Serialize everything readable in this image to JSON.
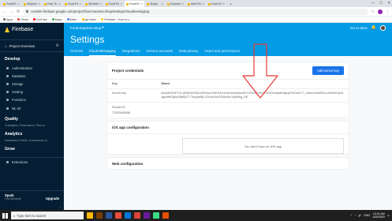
{
  "browser": {
    "tabs": [
      {
        "label": "Fossil Exo",
        "active": false
      },
      {
        "label": "Stripe/co",
        "active": false
      },
      {
        "label": "How To Se",
        "active": false
      },
      {
        "label": "Food Expr",
        "active": false
      },
      {
        "label": "Servlets",
        "active": false
      },
      {
        "label": "Food Exp",
        "active": false
      },
      {
        "label": "Fossil Exp",
        "active": true
      },
      {
        "label": "Shops",
        "active": false
      },
      {
        "label": "Document",
        "active": false
      },
      {
        "label": "Add Fireb",
        "active": false
      },
      {
        "label": "Food Exp",
        "active": false
      }
    ],
    "url": "console.firebase.google.com/project/food-express-shop/settings/cloudmessaging",
    "bookmarks": [
      "Apps",
      "Gmail",
      "YouTube",
      "Maps",
      "flutter",
      "get token",
      "Firebase - How to p..."
    ]
  },
  "sidebar": {
    "brand": "Firebase",
    "project_overview": "Project Overview",
    "sections": [
      {
        "title": "Develop",
        "items": [
          "Authentication",
          "Database",
          "Storage",
          "Hosting",
          "Functions",
          "ML Kit"
        ]
      },
      {
        "title": "Quality",
        "subtitle": "Crashlytics, Performance, Test La..."
      },
      {
        "title": "Analytics",
        "subtitle": "Dashboard, Events, Conversions, A..."
      },
      {
        "title": "Grow",
        "subtitle": ""
      }
    ],
    "extensions": "Extensions",
    "plan": {
      "name": "Spark",
      "subtitle": "Free $0/month",
      "upgrade": "Upgrade"
    }
  },
  "main": {
    "project_name": "Food-Express-shop",
    "docs_link": "Go to docs",
    "page_title": "Settings",
    "tabs": [
      "General",
      "Cloud Messaging",
      "Integrations",
      "Service accounts",
      "Data privacy",
      "Users and permissions"
    ],
    "active_tab": "Cloud Messaging",
    "credentials": {
      "title": "Project credentials",
      "add_button": "Add server key",
      "col_key": "Key",
      "col_token": "Token",
      "server_key_label": "Server key",
      "server_key_value": "AAAAEDSFT21:APA91bFEpXvEEfmLR9KGEXzVhHu4zNkeuZF1ZSn3GYN7YXf3ZZvhaMrMjsq2Y6ChoD F_m8uOovNHDG-nRNHGQ0Uxgw9fIKJj8qYM6Bj7T77mpaeRjLJOUwGhcDOMeSvlTqW9kg_HE",
      "sender_id_label": "Sender ID",
      "sender_id_value": "72353459558"
    },
    "ios": {
      "title": "iOS app configuration",
      "empty": "You don't have an iOS app"
    },
    "web": {
      "title": "Web configuration"
    }
  },
  "taskbar": {
    "search_placeholder": "Type here to search",
    "time": "10:41 AM",
    "date": "1/30/2020",
    "lang": "ENG"
  },
  "colors": {
    "firebase_blue": "#039be5",
    "sidebar_bg": "#051e34",
    "accent_button": "#1a73e8",
    "annotation_arrow": "#e53935"
  }
}
